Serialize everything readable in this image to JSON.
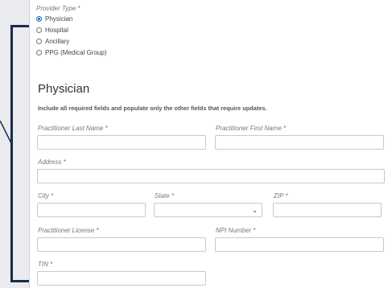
{
  "provider_type": {
    "label": "Provider Type *",
    "options": [
      {
        "label": "Physician",
        "selected": true
      },
      {
        "label": "Hospital",
        "selected": false
      },
      {
        "label": "Ancillary",
        "selected": false
      },
      {
        "label": "PPG (Medical Group)",
        "selected": false
      }
    ]
  },
  "section_title": "Physician",
  "instruction": "Include all required fields and populate only the other fields that require updates.",
  "fields": {
    "last_name": {
      "label": "Practitioner Last Name *",
      "value": ""
    },
    "first_name": {
      "label": "Practitioner First Name *",
      "value": ""
    },
    "address": {
      "label": "Address *",
      "value": ""
    },
    "city": {
      "label": "City *",
      "value": ""
    },
    "state": {
      "label": "State *",
      "value": ""
    },
    "zip": {
      "label": "ZIP *",
      "value": ""
    },
    "license": {
      "label": "Practitioner License *",
      "value": ""
    },
    "npi": {
      "label": "NPI Number *",
      "value": ""
    },
    "tin": {
      "label": "TIN *",
      "value": ""
    }
  },
  "icons": {
    "select_chevron": "chevron-down-icon"
  },
  "colors": {
    "accent": "#1565c0",
    "bracket": "#1a2a4a"
  }
}
